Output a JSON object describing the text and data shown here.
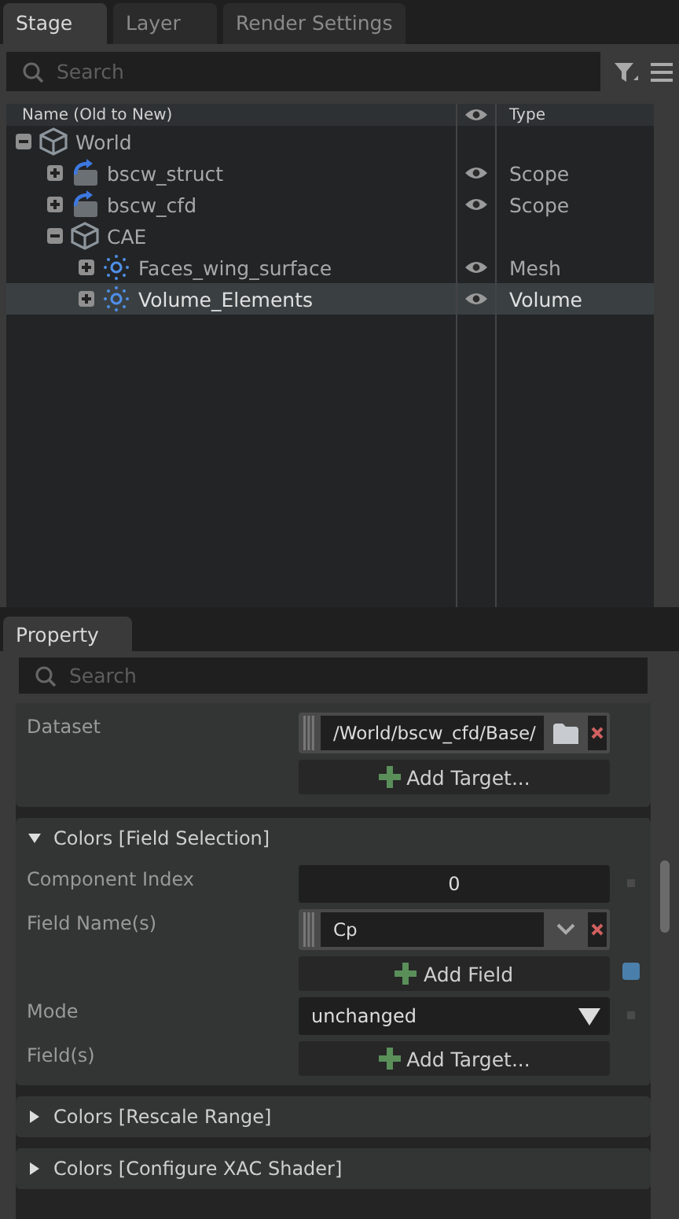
{
  "stage_panel": {
    "tabs": [
      {
        "label": "Stage",
        "selected": true
      },
      {
        "label": "Layer",
        "selected": false
      },
      {
        "label": "Render Settings",
        "selected": false
      }
    ],
    "search": {
      "placeholder": "Search"
    },
    "columns": {
      "name": "Name (Old to New)",
      "type": "Type"
    },
    "tree": [
      {
        "name": "World",
        "kind": "xform",
        "expanded": true,
        "selected": false,
        "children": [
          {
            "name": "bscw_struct",
            "kind": "scope",
            "type": "Scope",
            "visible": true,
            "expanded": false,
            "selected": false
          },
          {
            "name": "bscw_cfd",
            "kind": "scope",
            "type": "Scope",
            "visible": true,
            "expanded": false,
            "selected": false
          },
          {
            "name": "CAE",
            "kind": "xform",
            "expanded": true,
            "selected": false,
            "children": [
              {
                "name": "Faces_wing_surface",
                "kind": "mesh",
                "type": "Mesh",
                "visible": true,
                "expanded": false,
                "selected": false
              },
              {
                "name": "Volume_Elements",
                "kind": "mesh",
                "type": "Volume",
                "visible": true,
                "expanded": false,
                "selected": true
              }
            ]
          }
        ]
      }
    ]
  },
  "property_panel": {
    "tab": {
      "label": "Property",
      "selected": true
    },
    "search": {
      "placeholder": "Search"
    },
    "top_rows": [
      {
        "kind": "target",
        "label": "Dataset",
        "value": "/World/bscw_cfd/Base/",
        "button": "Add Target..."
      }
    ],
    "sections": [
      {
        "title": "Colors [Field Selection]",
        "expanded": true,
        "rows": [
          {
            "kind": "number",
            "label": "Component Index",
            "value": "0"
          },
          {
            "kind": "fieldlist",
            "label": "Field Name(s)",
            "value": "Cp",
            "button": "Add Field"
          },
          {
            "kind": "dropdown",
            "label": "Mode",
            "value": "unchanged"
          },
          {
            "kind": "add",
            "label": "Field(s)",
            "button": "Add Target..."
          }
        ]
      },
      {
        "title": "Colors [Rescale Range]",
        "expanded": false
      },
      {
        "title": "Colors [Configure XAC Shader]",
        "expanded": false
      }
    ]
  }
}
